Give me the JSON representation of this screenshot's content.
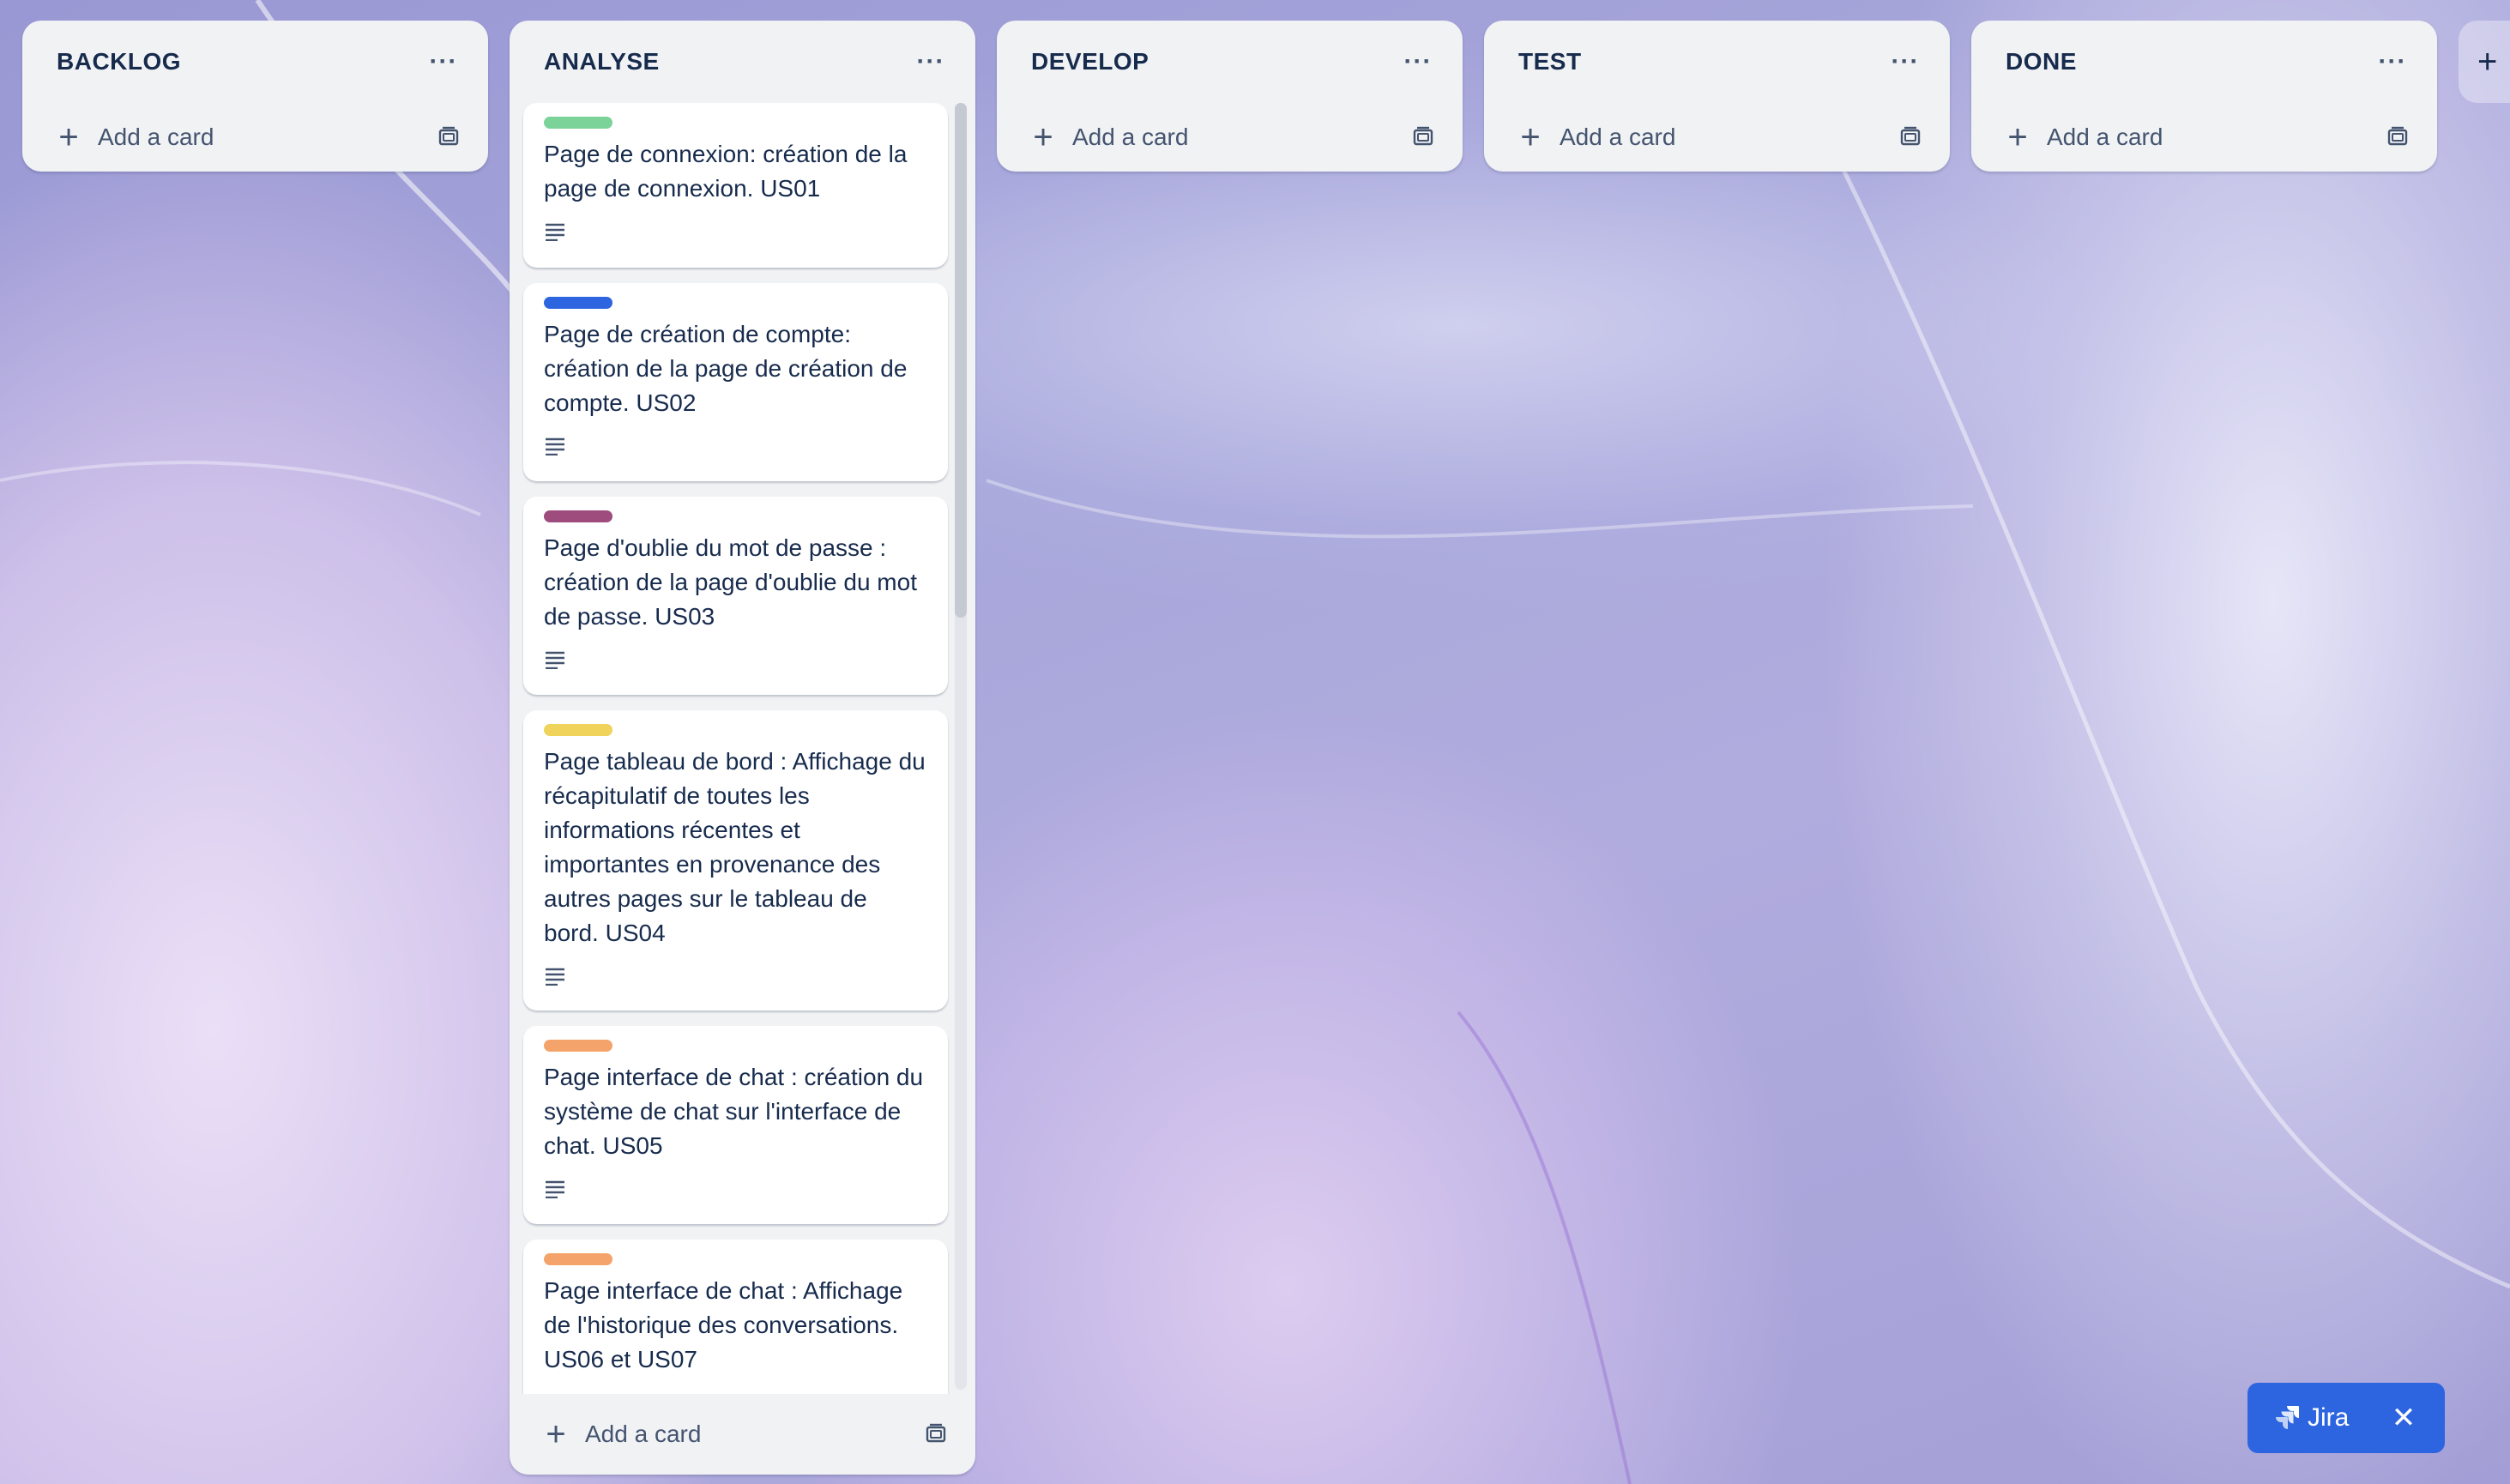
{
  "board": {
    "add_list_glyph": "+",
    "columns": [
      {
        "title": "BACKLOG",
        "menu": "···",
        "add_label": "Add a card"
      },
      {
        "title": "ANALYSE",
        "menu": "···",
        "add_label": "Add a card",
        "cards": [
          {
            "label_color": "#7bd39a",
            "title": "Page de connexion: création de la page de connexion. US01",
            "badge": "description-icon"
          },
          {
            "label_color": "#2d64e0",
            "title": "Page de création de compte: création de la page de création de compte. US02",
            "badge": "description-icon"
          },
          {
            "label_color": "#9e4b7e",
            "title": "Page d'oublie du mot de passe : création de la page d'oublie du mot de passe. US03",
            "badge": "description-icon"
          },
          {
            "label_color": "#efd35a",
            "title": "Page tableau de bord : Affichage du récapitulatif de toutes les informations récentes et importantes en provenance des autres pages sur le tableau de bord. US04",
            "badge": "description-icon"
          },
          {
            "label_color": "#f4a46a",
            "title": "Page interface de chat : création du système de chat sur l'interface de chat. US05",
            "badge": "description-icon"
          },
          {
            "label_color": "#f4a46a",
            "title": "Page interface de chat : Affichage de l'historique des conversations. US06 et US07",
            "badge": "description-icon"
          }
        ]
      },
      {
        "title": "DEVELOP",
        "menu": "···",
        "add_label": "Add a card"
      },
      {
        "title": "TEST",
        "menu": "···",
        "add_label": "Add a card"
      },
      {
        "title": "DONE",
        "menu": "···",
        "add_label": "Add a card"
      }
    ]
  },
  "jira": {
    "label": "Jira",
    "close_glyph": "✕"
  }
}
